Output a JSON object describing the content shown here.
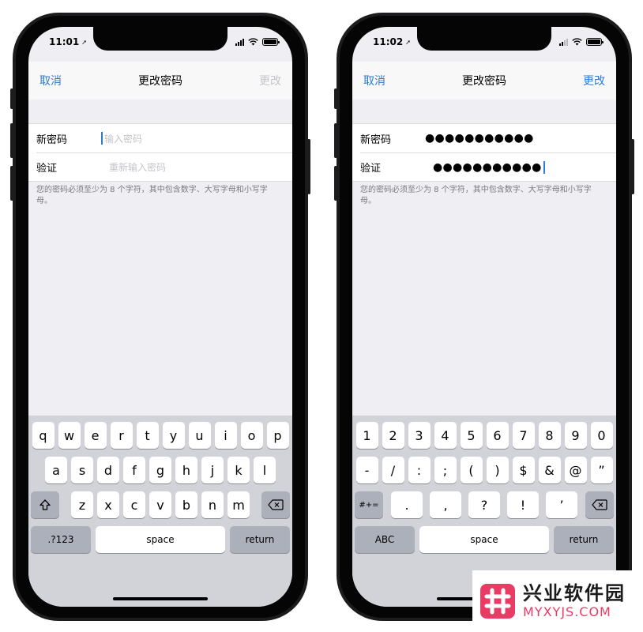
{
  "left": {
    "status": {
      "time": "11:01",
      "loc_arrow": "◀"
    },
    "nav": {
      "cancel": "取消",
      "title": "更改密码",
      "done": "更改"
    },
    "form": {
      "new_label": "新密码",
      "new_placeholder": "输入密码",
      "verify_label": "验证",
      "verify_placeholder": "重新输入密码"
    },
    "hint": "您的密码必须至少为 8 个字符，其中包含数字、大写字母和小写字母。",
    "keyboard": {
      "row1": [
        "q",
        "w",
        "e",
        "r",
        "t",
        "y",
        "u",
        "i",
        "o",
        "p"
      ],
      "row2": [
        "a",
        "s",
        "d",
        "f",
        "g",
        "h",
        "j",
        "k",
        "l"
      ],
      "row3": [
        "z",
        "x",
        "c",
        "v",
        "b",
        "n",
        "m"
      ],
      "mode": ".?123",
      "space": "space",
      "return": "return"
    }
  },
  "right": {
    "status": {
      "time": "11:02"
    },
    "nav": {
      "cancel": "取消",
      "title": "更改密码",
      "done": "更改"
    },
    "form": {
      "new_label": "新密码",
      "new_value": "●●●●●●●●●●●",
      "verify_label": "验证",
      "verify_value": "●●●●●●●●●●●"
    },
    "hint": "您的密码必须至少为 8 个字符，其中包含数字、大写字母和小写字母。",
    "keyboard": {
      "row1": [
        "1",
        "2",
        "3",
        "4",
        "5",
        "6",
        "7",
        "8",
        "9",
        "0"
      ],
      "row2": [
        "-",
        "/",
        ":",
        ";",
        "(",
        ")",
        "$",
        "&",
        "@",
        "”"
      ],
      "row3": [
        ".",
        ",",
        "?",
        "!",
        "’"
      ],
      "symbols": "#+=",
      "mode": "ABC",
      "space": "space",
      "return": "return"
    }
  },
  "watermark": {
    "name": "兴业软件园",
    "url": "MYXYJS.COM"
  },
  "icons": [
    "location-arrow-icon",
    "signal-icon",
    "wifi-icon",
    "battery-icon",
    "shift-icon",
    "delete-icon",
    "watermark-logo-icon"
  ]
}
